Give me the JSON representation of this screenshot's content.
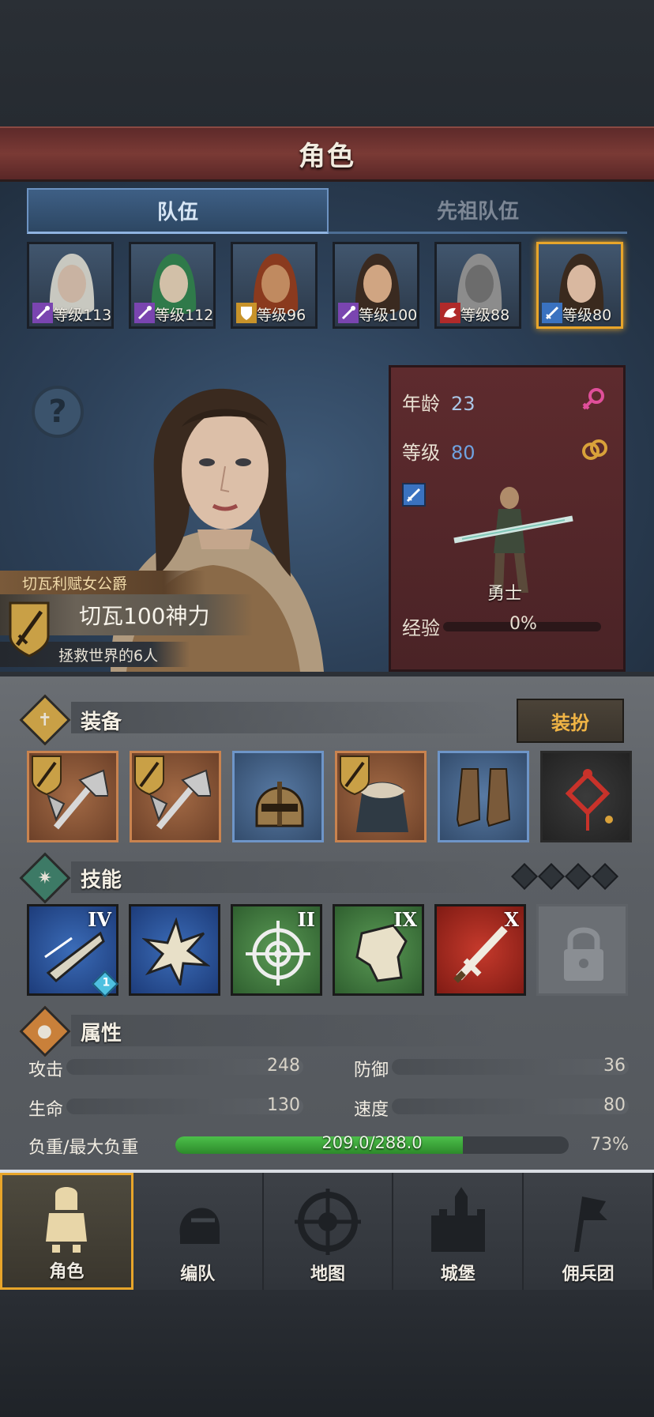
{
  "header": {
    "title": "角色"
  },
  "tabs": [
    {
      "label": "队伍",
      "active": true
    },
    {
      "label": "先祖队伍",
      "active": false
    }
  ],
  "heroes": [
    {
      "level_text": "等级113",
      "class_icon": "staff-icon",
      "class_color": "#7a45b0",
      "hair": "#c8c8c0",
      "skin": "#c9b3a2"
    },
    {
      "level_text": "等级112",
      "class_icon": "staff-icon",
      "class_color": "#7a45b0",
      "hair": "#2f7a4a",
      "skin": "#d2c0a8"
    },
    {
      "level_text": "等级96",
      "class_icon": "shield-icon",
      "class_color": "#c8932a",
      "hair": "#8a3a1e",
      "skin": "#c08a60"
    },
    {
      "level_text": "等级100",
      "class_icon": "staff-icon",
      "class_color": "#7a45b0",
      "hair": "#3a2a20",
      "skin": "#d0a582"
    },
    {
      "level_text": "等级88",
      "class_icon": "beast-icon",
      "class_color": "#b02a2a",
      "hair": "#8c8c8c",
      "skin": "#6c6c6c"
    },
    {
      "level_text": "等级80",
      "class_icon": "sword-icon",
      "class_color": "#3a72c0",
      "hair": "#3a2a1e",
      "skin": "#d9b8a0",
      "selected": true
    }
  ],
  "character": {
    "title": "切瓦利赋女公爵",
    "name": "切瓦100神力",
    "subtitle": "拯救世界的6人",
    "age_label": "年龄",
    "age": "23",
    "gender_icon": "female-icon",
    "level_label": "等级",
    "level": "80",
    "ring_icon": "ring-icon",
    "class_icon": "sword-icon",
    "job": "勇士",
    "exp_label": "经验",
    "exp_text": "0%",
    "exp_fraction": 0
  },
  "equipment": {
    "label": "装备",
    "dress_button": "装扮",
    "slots": [
      {
        "item": "axe-icon",
        "rarity": "orange",
        "crest": true
      },
      {
        "item": "axe-icon",
        "rarity": "orange",
        "crest": true
      },
      {
        "item": "helmet-icon",
        "rarity": "blue",
        "crest": false
      },
      {
        "item": "fur-armor-icon",
        "rarity": "orange",
        "crest": true
      },
      {
        "item": "boots-icon",
        "rarity": "blue",
        "crest": false
      },
      {
        "item": "knot-charm-icon",
        "rarity": "dark",
        "crest": false
      }
    ]
  },
  "skills": {
    "label": "技能",
    "items": [
      {
        "icon": "blade-strike-icon",
        "tier": "IV",
        "color": "blue",
        "badge": "1"
      },
      {
        "icon": "fist-burst-icon",
        "tier": "",
        "color": "blue",
        "badge": ""
      },
      {
        "icon": "target-icon",
        "tier": "II",
        "color": "green",
        "badge": ""
      },
      {
        "icon": "fist-icon",
        "tier": "IX",
        "color": "green",
        "badge": ""
      },
      {
        "icon": "sword-icon",
        "tier": "X",
        "color": "red",
        "badge": ""
      },
      {
        "icon": "lock-icon",
        "tier": "",
        "color": "locked",
        "badge": ""
      }
    ]
  },
  "attributes": {
    "label": "属性",
    "attack_label": "攻击",
    "attack": "248",
    "defense_label": "防御",
    "defense": "36",
    "hp_label": "生命",
    "hp": "130",
    "speed_label": "速度",
    "speed": "80",
    "load_label": "负重/最大负重",
    "load_text": "209.0/288.0",
    "load_percent": "73%",
    "load_fraction": 0.73
  },
  "nav": [
    {
      "label": "角色",
      "icon": "knight-icon",
      "active": true
    },
    {
      "label": "编队",
      "icon": "helmet-icon",
      "active": false
    },
    {
      "label": "地图",
      "icon": "compass-icon",
      "active": false
    },
    {
      "label": "城堡",
      "icon": "castle-icon",
      "active": false
    },
    {
      "label": "佣兵团",
      "icon": "banner-icon",
      "active": false
    }
  ]
}
